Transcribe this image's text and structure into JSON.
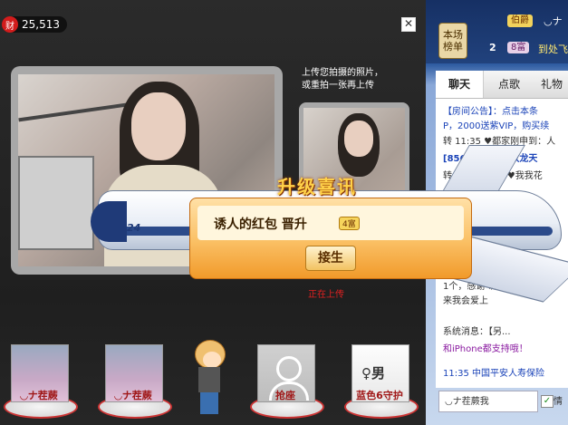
{
  "header": {
    "coin_icon": "财",
    "coin_amount": "25,513",
    "close_icon": "✕"
  },
  "upload": {
    "hint_line1": "上传您拍摄的照片，",
    "hint_line2": "或重拍一张再上传",
    "uploading_label": "正在上传"
  },
  "seats": [
    {
      "label": "◡ナ茬蕨"
    },
    {
      "label": "◡ナ茬蕨"
    },
    {
      "label": "抢座"
    },
    {
      "label": "蓝色6守护"
    }
  ],
  "boy_label": "男",
  "sidebar": {
    "ranking_tag": "本场\n榜单",
    "rank1_badge": "伯爵",
    "rank1_name": "◡ナ",
    "rank2_number": "2",
    "rank2_badge": "8富",
    "rank2_text": "到处飞",
    "tabs": [
      {
        "label": "聊天"
      },
      {
        "label": "点歌"
      },
      {
        "label": "礼物"
      }
    ],
    "chat_lines": [
      {
        "text": "【房间公告】：点击本条"
      },
      {
        "text": "P，2000送紫VIP，购买续"
      },
      {
        "text": "转 11:35 ♥都家刚申到：人"
      },
      {
        "text": "[856806] 说：双龙天"
      },
      {
        "text": "转 11:35 O◡♥♥我我花"
      },
      {
        "text": "1个，感谢 诱人的"
      },
      {
        "text": "来我会爱上"
      },
      {
        "text": "系统消息：【另..."
      },
      {
        "text": "和iPhone都支持哦！"
      },
      {
        "text": "11:35 中国平安人寿保险"
      }
    ],
    "input_value": "◡ナ茬蕨我",
    "check_label": "情"
  },
  "promo": {
    "title": "升级喜讯",
    "message_name": "诱人的红包",
    "message_action": "晋升",
    "badge": "4富",
    "button": "接生",
    "plane_logo": "24"
  }
}
